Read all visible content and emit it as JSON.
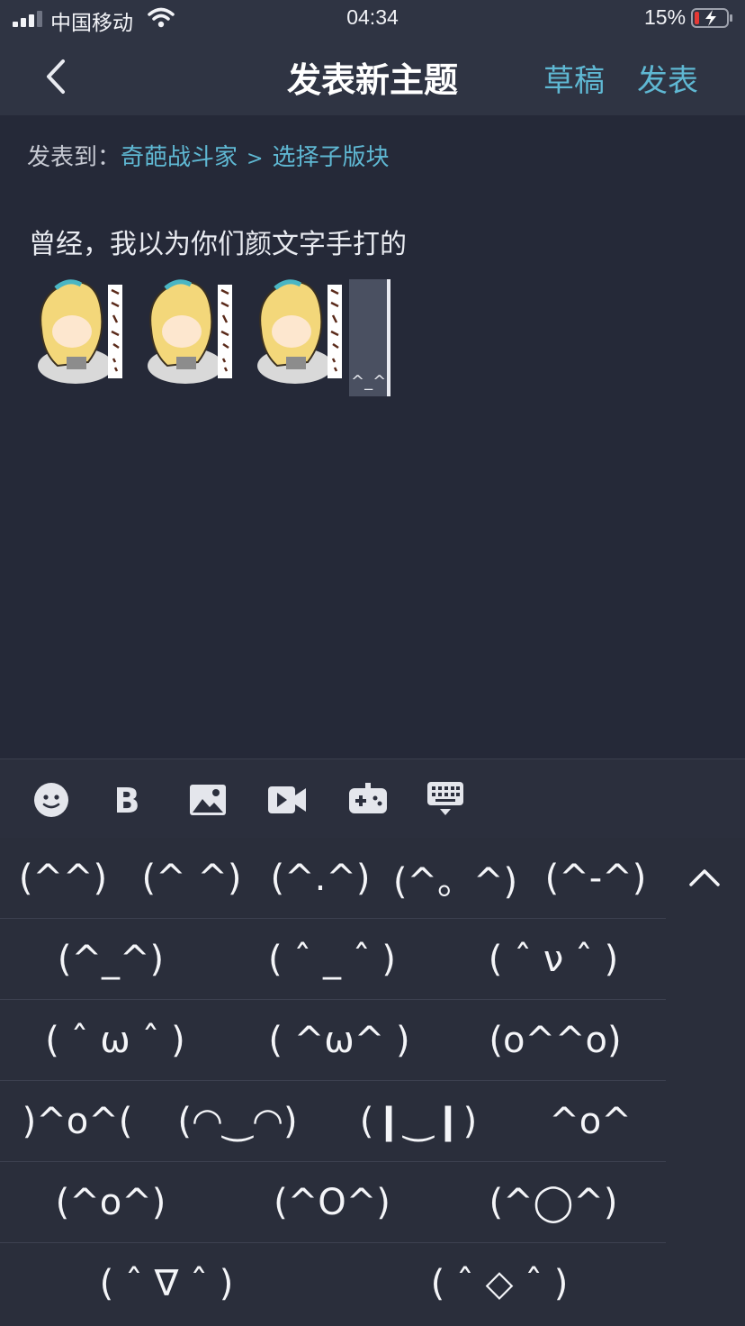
{
  "status_bar": {
    "carrier": "中国移动",
    "time": "04:34",
    "battery_percent": "15%",
    "battery_level": 0.15,
    "battery_color": "#e53935"
  },
  "nav": {
    "title": "发表新主题",
    "draft_label": "草稿",
    "publish_label": "发表",
    "accent_color": "#5fb8d3"
  },
  "post_to": {
    "label": "发表到：",
    "forum": "奇葩战斗家",
    "separator": ">",
    "sub_board": "选择子版块"
  },
  "content": {
    "text": "曾经，我以为你们颜文字手打的",
    "sticker_count": 3,
    "cursor_text": "^_^"
  },
  "toolbar": {
    "icons": [
      "emoji-icon",
      "bold-icon",
      "image-icon",
      "video-icon",
      "game-icon",
      "keyboard-icon"
    ]
  },
  "emoticons": {
    "rows": [
      [
        "(^^)",
        "(^ ^)",
        "(^.^)",
        "(^。^)",
        "(^-^)"
      ],
      [
        "(^_^)",
        "( ˆ _ ˆ )",
        "( ˆ ν ˆ )"
      ],
      [
        "( ˆ ω ˆ )",
        "( ^ω^ )",
        "(o^^o)"
      ],
      [
        ")^o^(",
        "(◠‿◠)",
        "(❙‿❙)",
        "^o^"
      ],
      [
        "(^o^)",
        "(^O^)",
        "(^◯^)"
      ],
      [
        "( ˆ ∇ ˆ )",
        "( ˆ ◇ ˆ )"
      ]
    ]
  }
}
